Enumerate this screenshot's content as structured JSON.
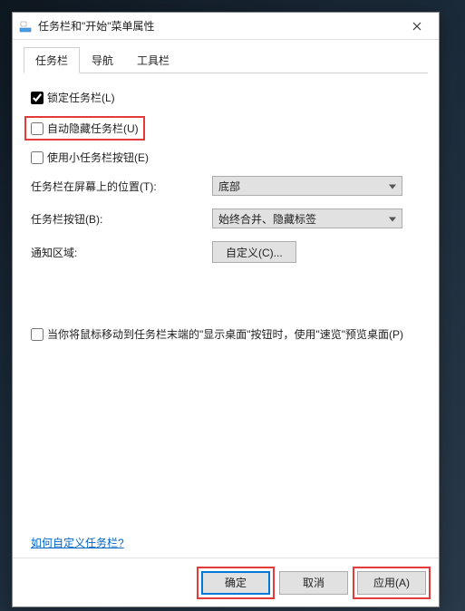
{
  "window": {
    "title": "任务栏和\"开始\"菜单属性"
  },
  "tabs": {
    "taskbar": "任务栏",
    "navigation": "导航",
    "toolbars": "工具栏"
  },
  "checkboxes": {
    "lock": "锁定任务栏(L)",
    "autohide": "自动隐藏任务栏(U)",
    "small": "使用小任务栏按钮(E)",
    "peek": "当你将鼠标移动到任务栏末端的\"显示桌面\"按钮时，使用\"速览\"预览桌面(P)"
  },
  "fields": {
    "location_label": "任务栏在屏幕上的位置(T):",
    "location_value": "底部",
    "buttons_label": "任务栏按钮(B):",
    "buttons_value": "始终合并、隐藏标签",
    "notify_label": "通知区域:",
    "customize_btn": "自定义(C)..."
  },
  "link": {
    "help": "如何自定义任务栏?"
  },
  "buttons": {
    "ok": "确定",
    "cancel": "取消",
    "apply": "应用(A)"
  }
}
